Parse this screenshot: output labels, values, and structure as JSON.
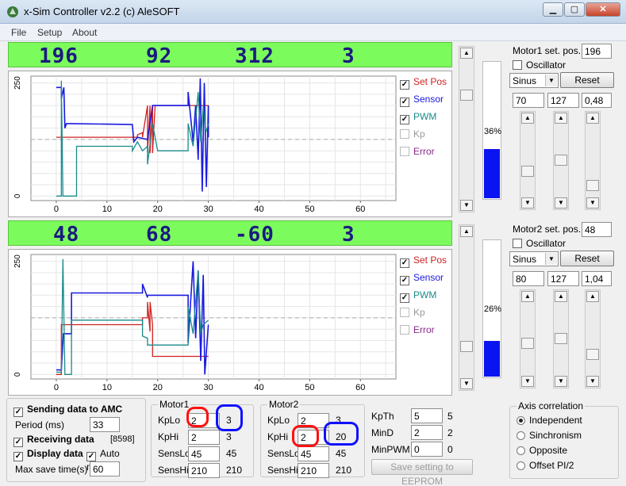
{
  "window": {
    "title": "x-Sim Controller v2.2 (c) AleSOFT",
    "minimize": "▁",
    "maximize": "▢",
    "close": "✕"
  },
  "menu": [
    "File",
    "Setup",
    "About"
  ],
  "colors": {
    "setpos": "#d02020",
    "sensor": "#1a1ae0",
    "pwm": "#1a8a8a",
    "kp": "#9a9a9a",
    "error": "#8a2a8a"
  },
  "motor1_panel": {
    "readouts": [
      "196",
      "92",
      "312",
      "3"
    ],
    "legend": [
      {
        "label": "Set Pos",
        "checked": true,
        "enabled": true,
        "color": "#d02020"
      },
      {
        "label": "Sensor",
        "checked": true,
        "enabled": true,
        "color": "#1a1ae0"
      },
      {
        "label": "PWM",
        "checked": true,
        "enabled": true,
        "color": "#1a8a8a"
      },
      {
        "label": "Kp",
        "checked": false,
        "enabled": false,
        "color": "#9a9a9a"
      },
      {
        "label": "Error",
        "checked": false,
        "enabled": false,
        "color": "#8a2a8a"
      }
    ],
    "gauge_percent_label": "36%",
    "gauge_fraction": 0.36,
    "set_pos_label": "Motor1 set. pos.",
    "set_pos_value": "196",
    "oscillator_label": "Oscillator",
    "wave": "Sinus",
    "reset": "Reset",
    "params": [
      "70",
      "127",
      "0,48"
    ]
  },
  "motor2_panel": {
    "readouts": [
      "48",
      "68",
      "-60",
      "3"
    ],
    "legend": [
      {
        "label": "Set Pos",
        "checked": true,
        "enabled": true,
        "color": "#d02020"
      },
      {
        "label": "Sensor",
        "checked": true,
        "enabled": true,
        "color": "#1a1ae0"
      },
      {
        "label": "PWM",
        "checked": true,
        "enabled": true,
        "color": "#1a8a8a"
      },
      {
        "label": "Kp",
        "checked": false,
        "enabled": false,
        "color": "#9a9a9a"
      },
      {
        "label": "Error",
        "checked": false,
        "enabled": false,
        "color": "#8a2a8a"
      }
    ],
    "gauge_percent_label": "26%",
    "gauge_fraction": 0.26,
    "set_pos_label": "Motor2 set. pos.",
    "set_pos_value": "48",
    "oscillator_label": "Oscillator",
    "wave": "Sinus",
    "reset": "Reset",
    "params": [
      "80",
      "127",
      "1,04"
    ]
  },
  "chart_data": [
    {
      "type": "line",
      "x_ticks": [
        "0",
        "10",
        "20",
        "30",
        "40",
        "50",
        "60"
      ],
      "y_ticks": [
        "250",
        "0"
      ],
      "xlim": [
        -5,
        67
      ],
      "ylim": [
        -10,
        265
      ],
      "grid": true,
      "series": [
        {
          "name": "Set Pos",
          "color": "#d02020",
          "points": [
            [
              0,
              130
            ],
            [
              16,
              130
            ],
            [
              16,
              135
            ],
            [
              17,
              140
            ],
            [
              17,
              130
            ],
            [
              18,
              200
            ],
            [
              18,
              95
            ],
            [
              18.5,
              200
            ],
            [
              18.5,
              95
            ],
            [
              19,
              200
            ],
            [
              19,
              95
            ],
            [
              19.5,
              200
            ],
            [
              19.5,
              200
            ],
            [
              30,
              200
            ],
            [
              30,
              130
            ]
          ]
        },
        {
          "name": "Sensor",
          "color": "#1a1ae0",
          "points": [
            [
              0,
              240
            ],
            [
              1,
              240
            ],
            [
              1,
              215
            ],
            [
              1.5,
              240
            ],
            [
              1.7,
              150
            ],
            [
              2,
              160
            ],
            [
              3,
              160
            ],
            [
              15,
              158
            ],
            [
              15.3,
              120
            ],
            [
              16,
              130
            ],
            [
              18,
              125
            ],
            [
              19,
              200
            ],
            [
              20,
              200
            ],
            [
              26,
              200
            ],
            [
              26,
              230
            ],
            [
              27,
              120
            ],
            [
              27.5,
              200
            ],
            [
              28,
              80
            ],
            [
              28.4,
              260
            ],
            [
              28.8,
              10
            ],
            [
              29.2,
              250
            ],
            [
              29.6,
              20
            ],
            [
              30,
              200
            ],
            [
              30,
              130
            ]
          ]
        },
        {
          "name": "PWM",
          "color": "#1a8a8a",
          "points": [
            [
              0,
              0
            ],
            [
              1,
              0
            ],
            [
              1,
              255
            ],
            [
              1.3,
              0
            ],
            [
              2,
              0
            ],
            [
              2,
              0
            ],
            [
              4,
              0
            ],
            [
              4,
              110
            ],
            [
              15,
              110
            ],
            [
              15,
              100
            ],
            [
              16,
              120
            ],
            [
              17,
              100
            ],
            [
              18,
              110
            ],
            [
              18,
              70
            ],
            [
              19,
              160
            ],
            [
              20,
              100
            ],
            [
              26,
              100
            ],
            [
              26,
              160
            ],
            [
              27,
              110
            ],
            [
              28,
              230
            ],
            [
              28.5,
              120
            ],
            [
              29,
              200
            ],
            [
              29.5,
              140
            ],
            [
              30,
              160
            ]
          ]
        }
      ]
    },
    {
      "type": "line",
      "x_ticks": [
        "0",
        "10",
        "20",
        "30",
        "40",
        "50",
        "60"
      ],
      "y_ticks": [
        "250",
        "0"
      ],
      "xlim": [
        -5,
        67
      ],
      "ylim": [
        -10,
        265
      ],
      "grid": true,
      "series": [
        {
          "name": "Set Pos",
          "color": "#d02020",
          "points": [
            [
              0,
              0
            ],
            [
              1,
              0
            ],
            [
              1,
              110
            ],
            [
              17,
              110
            ],
            [
              17,
              125
            ],
            [
              18,
              125
            ],
            [
              18,
              160
            ],
            [
              18.5,
              95
            ],
            [
              18.5,
              160
            ],
            [
              19,
              110
            ],
            [
              19,
              40
            ],
            [
              30,
              40
            ]
          ]
        },
        {
          "name": "Sensor",
          "color": "#1a1ae0",
          "points": [
            [
              0,
              10
            ],
            [
              1,
              10
            ],
            [
              1.4,
              90
            ],
            [
              3,
              90
            ],
            [
              3,
              180
            ],
            [
              17,
              180
            ],
            [
              17,
              200
            ],
            [
              18,
              170
            ],
            [
              18,
              175
            ],
            [
              26,
              175
            ],
            [
              26,
              70
            ],
            [
              27,
              250
            ],
            [
              27.5,
              80
            ],
            [
              28,
              230
            ],
            [
              28.5,
              30
            ],
            [
              29,
              220
            ],
            [
              29.3,
              0
            ],
            [
              30,
              110
            ]
          ]
        },
        {
          "name": "PWM",
          "color": "#1a8a8a",
          "points": [
            [
              0,
              5
            ],
            [
              1,
              5
            ],
            [
              1,
              0
            ],
            [
              1.3,
              255
            ],
            [
              1.7,
              0
            ],
            [
              2.5,
              0
            ],
            [
              3,
              0
            ],
            [
              3,
              120
            ],
            [
              17,
              120
            ],
            [
              17,
              85
            ],
            [
              18,
              80
            ],
            [
              18,
              65
            ],
            [
              26,
              65
            ],
            [
              26,
              150
            ],
            [
              27,
              90
            ],
            [
              28,
              230
            ],
            [
              28.5,
              90
            ],
            [
              29,
              110
            ],
            [
              30,
              120
            ]
          ]
        }
      ]
    }
  ],
  "settings": {
    "sending": "Sending data to AMC",
    "period_label": "Period (ms)",
    "period_value": "33",
    "receiving": "Receiving data",
    "counter": "[8598]",
    "display": "Display data",
    "auto_mode": "Auto mode",
    "max_save": "Max save time(s)",
    "max_save_value": "60"
  },
  "motor1_group": {
    "title": "Motor1",
    "rows": [
      {
        "label": "KpLo",
        "input": "2",
        "value": "3"
      },
      {
        "label": "KpHi",
        "input": "2",
        "value": "3"
      },
      {
        "label": "SensLo",
        "input": "45",
        "value": "45"
      },
      {
        "label": "SensHi",
        "input": "210",
        "value": "210"
      }
    ]
  },
  "motor2_group": {
    "title": "Motor2",
    "rows": [
      {
        "label": "KpLo",
        "input": "2",
        "value": "3"
      },
      {
        "label": "KpHi",
        "input": "2",
        "value": "20"
      },
      {
        "label": "SensLo",
        "input": "45",
        "value": "45"
      },
      {
        "label": "SensHi",
        "input": "210",
        "value": "210"
      }
    ]
  },
  "thresholds": {
    "rows": [
      {
        "label": "KpTh",
        "input": "5",
        "value": "5"
      },
      {
        "label": "MinD",
        "input": "2",
        "value": "2"
      },
      {
        "label": "MinPWM",
        "input": "0",
        "value": "0"
      }
    ],
    "eeprom_button": "Save setting to EEPROM"
  },
  "axis_correlation": {
    "title": "Axis correlation",
    "options": [
      {
        "label": "Independent",
        "selected": true
      },
      {
        "label": "Sinchronism",
        "selected": false
      },
      {
        "label": "Opposite",
        "selected": false
      },
      {
        "label": "Offset PI/2",
        "selected": false
      }
    ]
  }
}
